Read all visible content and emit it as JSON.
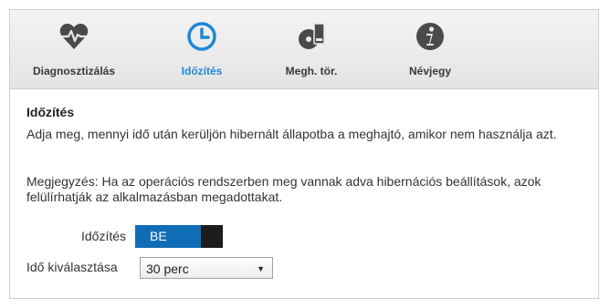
{
  "tabs": [
    {
      "label": "Diagnosztizálás",
      "icon": "heart-pulse-icon"
    },
    {
      "label": "Időzítés",
      "icon": "clock-icon"
    },
    {
      "label": "Megh. tör.",
      "icon": "drive-erase-icon"
    },
    {
      "label": "Névjegy",
      "icon": "info-icon"
    }
  ],
  "active_tab": "Időzítés",
  "colors": {
    "accent": "#1e88d8",
    "toggle_on": "#0f6db6",
    "icon_gray": "#4a4a4a"
  },
  "section": {
    "title": "Időzítés",
    "description": "Adja meg, mennyi idő után kerüljön hibernált állapotba a meghajtó, amikor nem használja azt.",
    "note": "Megjegyzés: Ha az operációs rendszerben meg vannak adva hibernációs beállítások, azok felülírhatják az alkalmazásban megadottakat."
  },
  "timer_toggle": {
    "label": "Időzítés",
    "state_text": "BE"
  },
  "time_select": {
    "label": "Idő kiválasztása",
    "value": "30 perc"
  }
}
